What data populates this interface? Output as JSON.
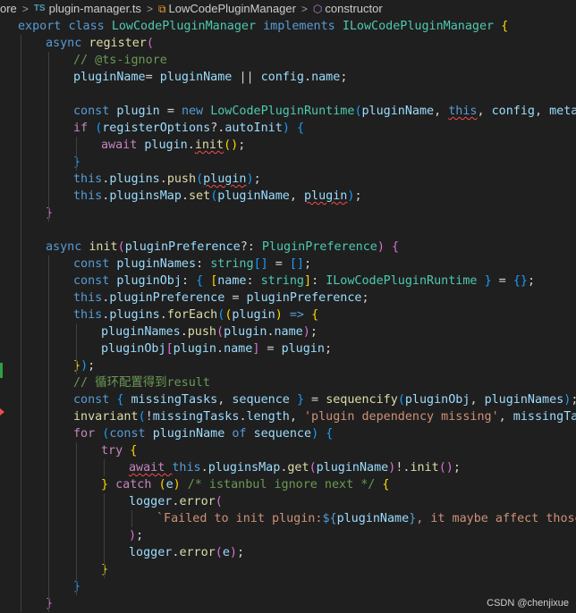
{
  "breadcrumb": {
    "items": [
      {
        "label": "ore",
        "icon": ""
      },
      {
        "label": "plugin-manager.ts",
        "icon": "TS"
      },
      {
        "label": "LowCodePluginManager",
        "icon": "class-icon"
      },
      {
        "label": "constructor",
        "icon": "method-icon"
      }
    ],
    "separator": ">"
  },
  "code": {
    "language": "typescript",
    "lines": [
      {
        "indent": 0,
        "tokens": [
          [
            "kw",
            "export "
          ],
          [
            "kw",
            "class "
          ],
          [
            "cls",
            "LowCodePluginManager "
          ],
          [
            "kw",
            "implements "
          ],
          [
            "cls",
            "ILowCodePluginManager "
          ],
          [
            "b1",
            "{"
          ]
        ]
      },
      {
        "indent": 1,
        "tokens": [
          [
            "kw",
            "async "
          ],
          [
            "fn",
            "register"
          ],
          [
            "b2",
            "("
          ]
        ]
      },
      {
        "indent": 2,
        "tokens": [
          [
            "cmt",
            "// @ts-ignore"
          ]
        ]
      },
      {
        "indent": 2,
        "tokens": [
          [
            "var",
            "pluginName"
          ],
          [
            "",
            "= "
          ],
          [
            "var",
            "pluginName "
          ],
          [
            "",
            "|| "
          ],
          [
            "var",
            "config"
          ],
          [
            "",
            "."
          ],
          [
            "var",
            "name"
          ],
          [
            "",
            ";"
          ]
        ]
      },
      {
        "indent": 0,
        "tokens": []
      },
      {
        "indent": 2,
        "tokens": [
          [
            "kw",
            "const "
          ],
          [
            "var",
            "plugin "
          ],
          [
            "",
            "= "
          ],
          [
            "kw",
            "new "
          ],
          [
            "cls",
            "LowCodePluginRuntime"
          ],
          [
            "b3",
            "("
          ],
          [
            "var",
            "pluginName"
          ],
          [
            "",
            " , "
          ],
          [
            "kw sq",
            "this"
          ],
          [
            "",
            ", "
          ],
          [
            "var",
            "config"
          ],
          [
            "",
            ", "
          ],
          [
            "var",
            "meta"
          ],
          [
            "b3",
            ")"
          ],
          [
            "",
            ";"
          ]
        ]
      },
      {
        "indent": 2,
        "tokens": [
          [
            "ctl",
            "if "
          ],
          [
            "b3",
            "("
          ],
          [
            "var",
            "registerOptions"
          ],
          [
            "",
            "?."
          ],
          [
            "var",
            "autoInit"
          ],
          [
            "b3",
            ")"
          ],
          [
            "",
            " "
          ],
          [
            "b3",
            "{"
          ]
        ]
      },
      {
        "indent": 3,
        "tokens": [
          [
            "ctl",
            "await "
          ],
          [
            "var",
            "plugin"
          ],
          [
            "",
            "."
          ],
          [
            "fn sq",
            "init"
          ],
          [
            "b1",
            "()"
          ],
          [
            "",
            ";"
          ]
        ]
      },
      {
        "indent": 2,
        "tokens": [
          [
            "b3",
            "}"
          ]
        ]
      },
      {
        "indent": 2,
        "tokens": [
          [
            "kw",
            "this"
          ],
          [
            "",
            "."
          ],
          [
            "var",
            "plugins"
          ],
          [
            "",
            "."
          ],
          [
            "fn",
            "push"
          ],
          [
            "b3",
            "("
          ],
          [
            "var sq",
            "plugin"
          ],
          [
            "b3",
            ")"
          ],
          [
            "",
            ";"
          ]
        ]
      },
      {
        "indent": 2,
        "tokens": [
          [
            "kw",
            "this"
          ],
          [
            "",
            "."
          ],
          [
            "var",
            "pluginsMap"
          ],
          [
            "",
            "."
          ],
          [
            "fn",
            "set"
          ],
          [
            "b3",
            "("
          ],
          [
            "var",
            "pluginName"
          ],
          [
            "",
            ", "
          ],
          [
            "var sq",
            "plugin"
          ],
          [
            "b3",
            ")"
          ],
          [
            "",
            ";"
          ]
        ]
      },
      {
        "indent": 1,
        "tokens": [
          [
            "b2",
            "}"
          ]
        ]
      },
      {
        "indent": 0,
        "tokens": []
      },
      {
        "indent": 1,
        "tokens": [
          [
            "kw",
            "async "
          ],
          [
            "fn",
            "init"
          ],
          [
            "b2",
            "("
          ],
          [
            "var",
            "pluginPreference"
          ],
          [
            "",
            "?: "
          ],
          [
            "cls",
            "PluginPreference"
          ],
          [
            "b2",
            ")"
          ],
          [
            "",
            " "
          ],
          [
            "b2",
            "{"
          ]
        ]
      },
      {
        "indent": 2,
        "tokens": [
          [
            "kw",
            "const "
          ],
          [
            "var",
            "pluginNames"
          ],
          [
            "",
            ": "
          ],
          [
            "cls",
            "string"
          ],
          [
            "b3",
            "[]"
          ],
          [
            "",
            " = "
          ],
          [
            "b3",
            "[]"
          ],
          [
            "",
            ";"
          ]
        ]
      },
      {
        "indent": 2,
        "tokens": [
          [
            "kw",
            "const "
          ],
          [
            "var",
            "pluginObj"
          ],
          [
            "",
            ": "
          ],
          [
            "b3",
            "{ "
          ],
          [
            "b1",
            "["
          ],
          [
            "var",
            "name"
          ],
          [
            "",
            ": "
          ],
          [
            "cls",
            "string"
          ],
          [
            "b1",
            "]"
          ],
          [
            "",
            ": "
          ],
          [
            "cls",
            "ILowCodePluginRuntime "
          ],
          [
            "b3",
            "}"
          ],
          [
            "",
            " = "
          ],
          [
            "b3",
            "{}"
          ],
          [
            "",
            ";"
          ]
        ]
      },
      {
        "indent": 2,
        "tokens": [
          [
            "kw",
            "this"
          ],
          [
            "",
            "."
          ],
          [
            "var",
            "pluginPreference"
          ],
          [
            "",
            " = "
          ],
          [
            "var",
            "pluginPreference"
          ],
          [
            "",
            ";"
          ]
        ]
      },
      {
        "indent": 2,
        "tokens": [
          [
            "kw",
            "this"
          ],
          [
            "",
            "."
          ],
          [
            "var",
            "plugins"
          ],
          [
            "",
            "."
          ],
          [
            "fn",
            "forEach"
          ],
          [
            "b3",
            "("
          ],
          [
            "b1",
            "("
          ],
          [
            "var",
            "plugin"
          ],
          [
            "b1",
            ")"
          ],
          [
            "",
            " "
          ],
          [
            "kw",
            "=>"
          ],
          [
            "",
            " "
          ],
          [
            "b1",
            "{"
          ]
        ]
      },
      {
        "indent": 3,
        "tokens": [
          [
            "var",
            "pluginNames"
          ],
          [
            "",
            "."
          ],
          [
            "fn",
            "push"
          ],
          [
            "b2",
            "("
          ],
          [
            "var",
            "plugin"
          ],
          [
            "",
            "."
          ],
          [
            "var",
            "name"
          ],
          [
            "b2",
            ")"
          ],
          [
            "",
            ";"
          ]
        ]
      },
      {
        "indent": 3,
        "tokens": [
          [
            "var",
            "pluginObj"
          ],
          [
            "b2",
            "["
          ],
          [
            "var",
            "plugin"
          ],
          [
            "",
            "."
          ],
          [
            "var",
            "name"
          ],
          [
            "b2",
            "]"
          ],
          [
            "",
            " = "
          ],
          [
            "var",
            "plugin"
          ],
          [
            "",
            ";"
          ]
        ]
      },
      {
        "indent": 2,
        "tokens": [
          [
            "b1",
            "}"
          ],
          [
            "b3",
            ")"
          ],
          [
            "",
            ";"
          ]
        ]
      },
      {
        "indent": 2,
        "tokens": [
          [
            "cmt",
            "// 循环配置得到result"
          ]
        ]
      },
      {
        "indent": 2,
        "tokens": [
          [
            "kw",
            "const "
          ],
          [
            "b3",
            "{ "
          ],
          [
            "var",
            "missingTasks"
          ],
          [
            "",
            ", "
          ],
          [
            "var",
            "sequence "
          ],
          [
            "b3",
            "}"
          ],
          [
            "",
            " = "
          ],
          [
            "fn",
            "sequencify"
          ],
          [
            "b3",
            "("
          ],
          [
            "var",
            "pluginObj"
          ],
          [
            "",
            ", "
          ],
          [
            "var",
            "pluginNames"
          ],
          [
            "b3",
            ")"
          ],
          [
            "",
            ";"
          ]
        ]
      },
      {
        "indent": 2,
        "tokens": [
          [
            "fn",
            "invariant"
          ],
          [
            "b3",
            "("
          ],
          [
            "",
            "!"
          ],
          [
            "var",
            "missingTasks"
          ],
          [
            "",
            "."
          ],
          [
            "var",
            "length"
          ],
          [
            "",
            ", "
          ],
          [
            "str",
            "'plugin dependency missing'"
          ],
          [
            "",
            ", "
          ],
          [
            "var",
            "missingTasks"
          ]
        ]
      },
      {
        "indent": 2,
        "tokens": [
          [
            "ctl",
            "for "
          ],
          [
            "b3",
            "("
          ],
          [
            "kw",
            "const "
          ],
          [
            "var",
            "pluginName "
          ],
          [
            "kw",
            "of "
          ],
          [
            "var",
            "sequence"
          ],
          [
            "b3",
            ")"
          ],
          [
            "",
            " "
          ],
          [
            "b3",
            "{"
          ]
        ]
      },
      {
        "indent": 3,
        "tokens": [
          [
            "ctl",
            "try "
          ],
          [
            "b1",
            "{"
          ]
        ]
      },
      {
        "indent": 4,
        "tokens": [
          [
            "ctl sq",
            "await "
          ],
          [
            "kw",
            "this"
          ],
          [
            "",
            "."
          ],
          [
            "var",
            "pluginsMap"
          ],
          [
            "",
            "."
          ],
          [
            "fn",
            "get"
          ],
          [
            "b2",
            "("
          ],
          [
            "var",
            "pluginName"
          ],
          [
            "b2",
            ")"
          ],
          [
            "",
            "!."
          ],
          [
            "fn",
            "init"
          ],
          [
            "b2",
            "()"
          ],
          [
            "",
            ";"
          ]
        ]
      },
      {
        "indent": 3,
        "tokens": [
          [
            "b1",
            "}"
          ],
          [
            "",
            " "
          ],
          [
            "ctl",
            "catch "
          ],
          [
            "b1",
            "("
          ],
          [
            "var",
            "e"
          ],
          [
            "b1",
            ")"
          ],
          [
            "",
            " "
          ],
          [
            "cmt",
            "/* istanbul ignore next */"
          ],
          [
            "",
            " "
          ],
          [
            "b1",
            "{"
          ]
        ]
      },
      {
        "indent": 4,
        "tokens": [
          [
            "var",
            "logger"
          ],
          [
            "",
            "."
          ],
          [
            "fn",
            "error"
          ],
          [
            "b2",
            "("
          ]
        ]
      },
      {
        "indent": 5,
        "tokens": [
          [
            "str",
            "`Failed to init plugin:"
          ],
          [
            "kw",
            "${"
          ],
          [
            "var",
            "pluginName"
          ],
          [
            "kw",
            "}"
          ],
          [
            "str",
            ", it maybe affect those p"
          ]
        ]
      },
      {
        "indent": 4,
        "tokens": [
          [
            "b2",
            ")"
          ],
          [
            "",
            ";"
          ]
        ]
      },
      {
        "indent": 4,
        "tokens": [
          [
            "var",
            "logger"
          ],
          [
            "",
            "."
          ],
          [
            "fn",
            "error"
          ],
          [
            "b2",
            "("
          ],
          [
            "var",
            "e"
          ],
          [
            "b2",
            ")"
          ],
          [
            "",
            ";"
          ]
        ]
      },
      {
        "indent": 3,
        "tokens": [
          [
            "b1",
            "}"
          ]
        ]
      },
      {
        "indent": 2,
        "tokens": [
          [
            "b3",
            "}"
          ]
        ]
      },
      {
        "indent": 1,
        "tokens": [
          [
            "b2",
            "}"
          ]
        ]
      }
    ]
  },
  "watermark": "CSDN @chenjixue"
}
